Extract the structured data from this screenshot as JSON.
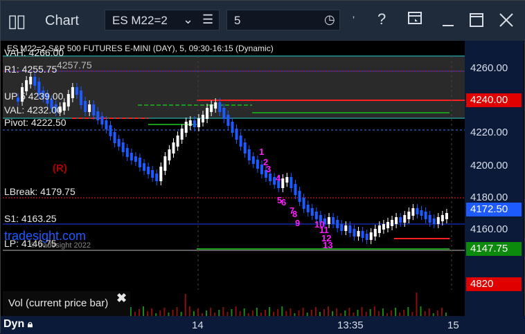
{
  "window": {
    "app_title": "Chart",
    "icon": "grid-icon"
  },
  "toolbar": {
    "symbol": "ES M22=2",
    "interval": "5",
    "icons": [
      "chevron-down-icon",
      "list-icon",
      "clock-icon",
      "tilde-icon",
      "help-icon",
      "layout-icon",
      "maximize-icon",
      "close-icon"
    ],
    "help": "?"
  },
  "chart": {
    "header": "ES M22=2 S&P 500 FUTURES E-MINI (DAY), 5, 09:30-16:15 (Dynamic)",
    "levels": {
      "vah": "VAH: 4266.00",
      "hod": "4257.75",
      "r1": "R1: 4255.75",
      "up": "UP 5 4239.00",
      "val": "VAL: 4232.00",
      "pivot": "Pivot: 4222.50",
      "lbreak": "LBreak: 4179.75",
      "s1": "S1: 4163.25",
      "lp": "LP: 4146.75"
    },
    "marker_r": "(R)",
    "watermark": "tradesight.com",
    "copyright": "© tradesight 2022",
    "sequence_labels": [
      "1",
      "2",
      "3",
      "4",
      "5",
      "6",
      "7",
      "8",
      "9",
      "10",
      "11",
      "12",
      "13"
    ],
    "colors": {
      "up_candle": "#ffffff",
      "down_candle": "#1e5bff",
      "magenta": "#ff1aff",
      "green": "#1a9a1a",
      "resistance": "#ff2020"
    }
  },
  "price_axis": {
    "ticks": [
      "4260.00",
      "4240.00",
      "4220.00",
      "4200.00",
      "4180.00",
      "4160.00"
    ],
    "tag_red": "4240.00",
    "tag_blue": "4172.50",
    "tag_green": "4147.75"
  },
  "volume": {
    "label": "Vol (current price bar)",
    "close": "✖",
    "value_tag": "4820"
  },
  "time_axis": {
    "mode": "Dyn",
    "labels": [
      "14",
      "13:35",
      "15"
    ]
  }
}
